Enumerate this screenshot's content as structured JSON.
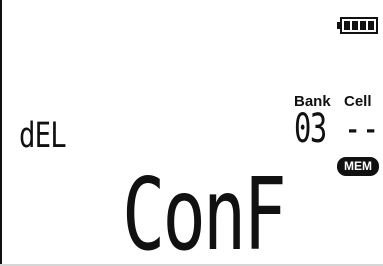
{
  "display": {
    "mode_text": "dEL",
    "main_text": "ConF",
    "bank": {
      "label": "Bank",
      "value": "03"
    },
    "cell": {
      "label": "Cell",
      "value": "--"
    },
    "badge": "MEM",
    "battery": {
      "level": 1.0,
      "icon": "battery-icon"
    }
  },
  "colors": {
    "background": "#ffffff",
    "foreground": "#111111"
  }
}
